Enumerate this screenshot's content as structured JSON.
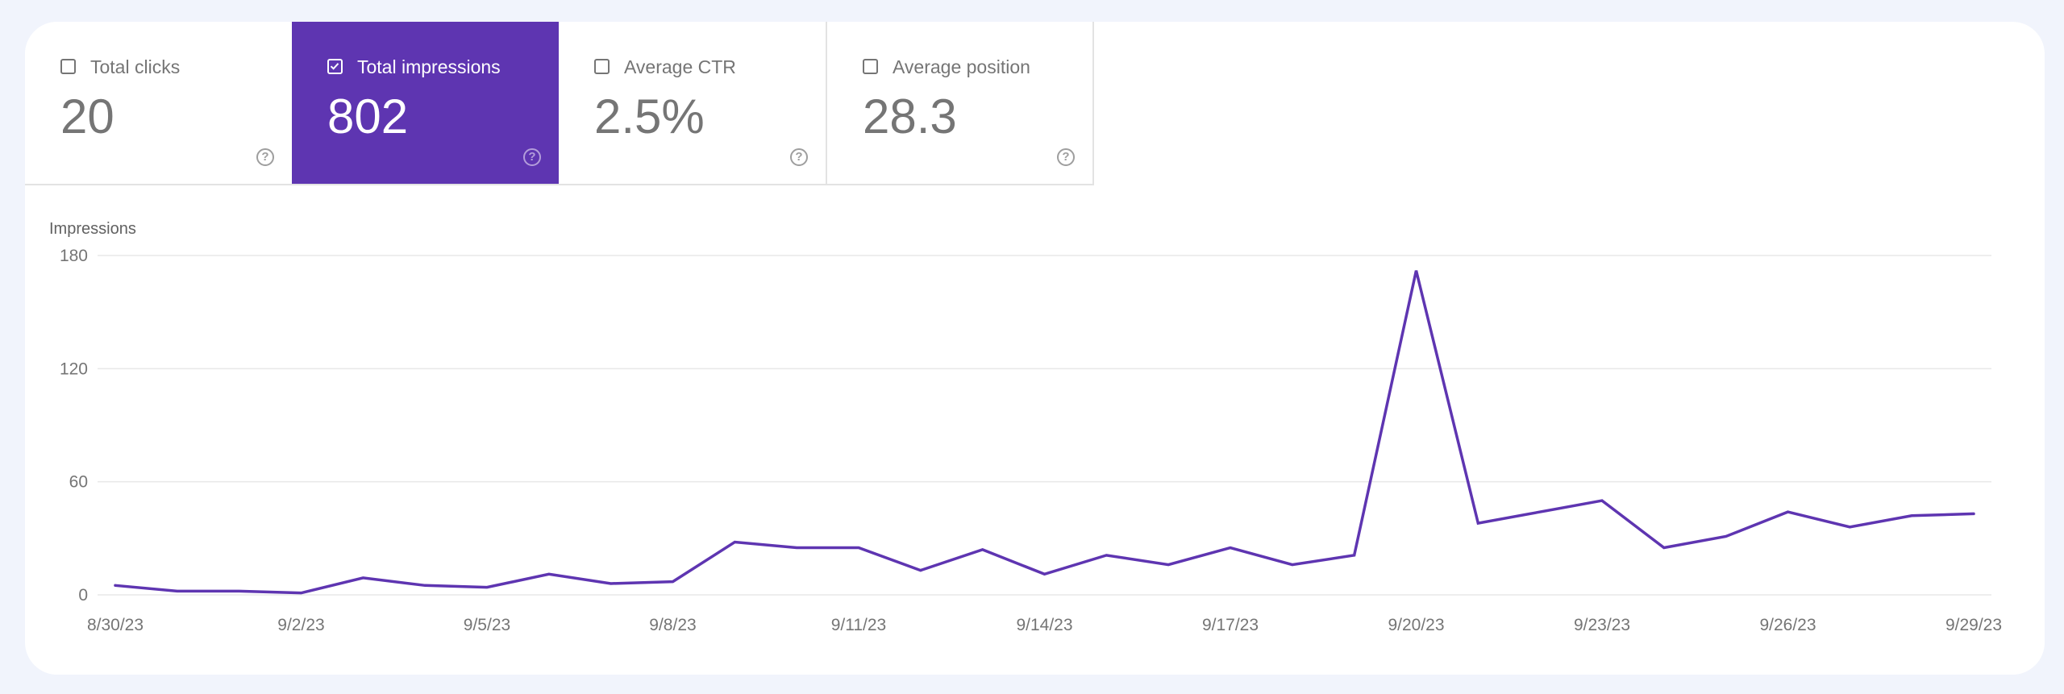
{
  "metrics": [
    {
      "label": "Total clicks",
      "value": "20",
      "checked": false
    },
    {
      "label": "Total impressions",
      "value": "802",
      "checked": true
    },
    {
      "label": "Average CTR",
      "value": "2.5%",
      "checked": false
    },
    {
      "label": "Average position",
      "value": "28.3",
      "checked": false
    }
  ],
  "help_glyph": "?",
  "colors": {
    "accent": "#5e35b1",
    "line": "#5e35b1",
    "grid": "#e8e8e8",
    "page_bg": "#f1f4fc"
  },
  "chart_data": {
    "type": "line",
    "title": "",
    "ylabel": "Impressions",
    "xlabel": "",
    "ylim": [
      0,
      180
    ],
    "yticks": [
      0,
      60,
      120,
      180
    ],
    "grid": true,
    "x": [
      "8/30/23",
      "8/31/23",
      "9/1/23",
      "9/2/23",
      "9/3/23",
      "9/4/23",
      "9/5/23",
      "9/6/23",
      "9/7/23",
      "9/8/23",
      "9/9/23",
      "9/10/23",
      "9/11/23",
      "9/12/23",
      "9/13/23",
      "9/14/23",
      "9/15/23",
      "9/16/23",
      "9/17/23",
      "9/18/23",
      "9/19/23",
      "9/20/23",
      "9/21/23",
      "9/22/23",
      "9/23/23",
      "9/24/23",
      "9/25/23",
      "9/26/23",
      "9/27/23",
      "9/28/23",
      "9/29/23"
    ],
    "xtick_labels": [
      "8/30/23",
      "9/2/23",
      "9/5/23",
      "9/8/23",
      "9/11/23",
      "9/14/23",
      "9/17/23",
      "9/20/23",
      "9/23/23",
      "9/26/23",
      "9/29/23"
    ],
    "series": [
      {
        "name": "Impressions",
        "values": [
          5,
          2,
          2,
          1,
          9,
          5,
          4,
          11,
          6,
          7,
          28,
          25,
          25,
          13,
          24,
          11,
          21,
          16,
          25,
          16,
          21,
          172,
          38,
          44,
          50,
          25,
          31,
          44,
          36,
          42,
          43
        ]
      }
    ]
  }
}
